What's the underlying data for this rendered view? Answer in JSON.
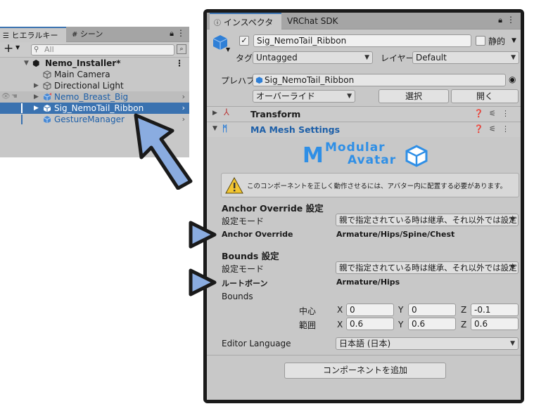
{
  "hierarchy": {
    "tabs": [
      "ヒエラルキー",
      "シーン"
    ],
    "search_placeholder": "All",
    "scene_name": "Nemo_Installer*",
    "items": [
      {
        "label": "Main Camera"
      },
      {
        "label": "Directional Light"
      },
      {
        "label": "Nemo_Breast_Big"
      },
      {
        "label": "Sig_NemoTail_Ribbon"
      },
      {
        "label": "GestureManager"
      }
    ]
  },
  "inspector": {
    "tabs": [
      "インスペクター",
      "VRChat SDK"
    ],
    "object_name": "Sig_NemoTail_Ribbon",
    "static_label": "静的",
    "tag_label": "タグ",
    "tag_value": "Untagged",
    "layer_label": "レイヤー",
    "layer_value": "Default",
    "prefab_label": "プレハブ",
    "prefab_value": "Sig_NemoTail_Ribbon",
    "overrides_label": "オーバーライド",
    "select_button": "選択",
    "open_button": "開く",
    "components": [
      {
        "title": "Transform"
      },
      {
        "title": "MA Mesh Settings"
      }
    ],
    "logo_text": [
      "Modular",
      "Avatar"
    ],
    "warning_text": "このコンポーネントを正しく動作させるには、アバター内に配置する必要があります。",
    "anchor_section": "Anchor Override 設定",
    "anchor_mode_label": "設定モード",
    "anchor_mode_value": "親で指定されている時は継承、それ以外では設定",
    "anchor_override_label": "Anchor Override",
    "anchor_override_value": "Armature/Hips/Spine/Chest",
    "bounds_section": "Bounds 設定",
    "bounds_mode_label": "設定モード",
    "bounds_mode_value": "親で指定されている時は継承、それ以外では設定",
    "root_bone_label": "ルートボーン",
    "root_bone_value": "Armature/Hips",
    "bounds_label": "Bounds",
    "center_label": "中心",
    "extent_label": "範囲",
    "axis": [
      "X",
      "Y",
      "Z"
    ],
    "center": [
      "0",
      "0",
      "-0.1"
    ],
    "extent": [
      "0.6",
      "0.6",
      "0.6"
    ],
    "editor_language_label": "Editor Language",
    "editor_language_value": "日本語 (日本)",
    "add_component_button": "コンポーネントを追加"
  },
  "colors": {
    "selection": "#3a72b0",
    "accent_arrow": "#8aace0",
    "prefab_text": "#1d5fa8"
  }
}
